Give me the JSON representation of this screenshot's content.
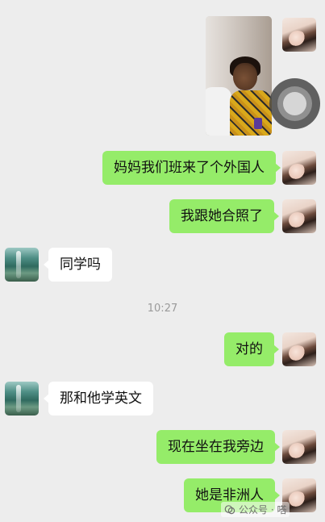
{
  "messages": [
    {
      "from": "me",
      "type": "image"
    },
    {
      "from": "me",
      "text": "妈妈我们班来了个外国人"
    },
    {
      "from": "me",
      "text": "我跟她合照了"
    },
    {
      "from": "friend",
      "text": "同学吗"
    },
    {
      "time": "10:27"
    },
    {
      "from": "me",
      "text": "对的"
    },
    {
      "from": "friend",
      "text": "那和他学英文"
    },
    {
      "from": "me",
      "text": "现在坐在我旁边"
    },
    {
      "from": "me",
      "text": "她是非洲人"
    }
  ],
  "watermark": {
    "icon": "wechat-official-account-icon",
    "text": "公众号 · 嗒"
  },
  "colors": {
    "background": "#ededed",
    "my_bubble": "#95ec69",
    "friend_bubble": "#ffffff",
    "time_text": "#9a9a9a"
  }
}
